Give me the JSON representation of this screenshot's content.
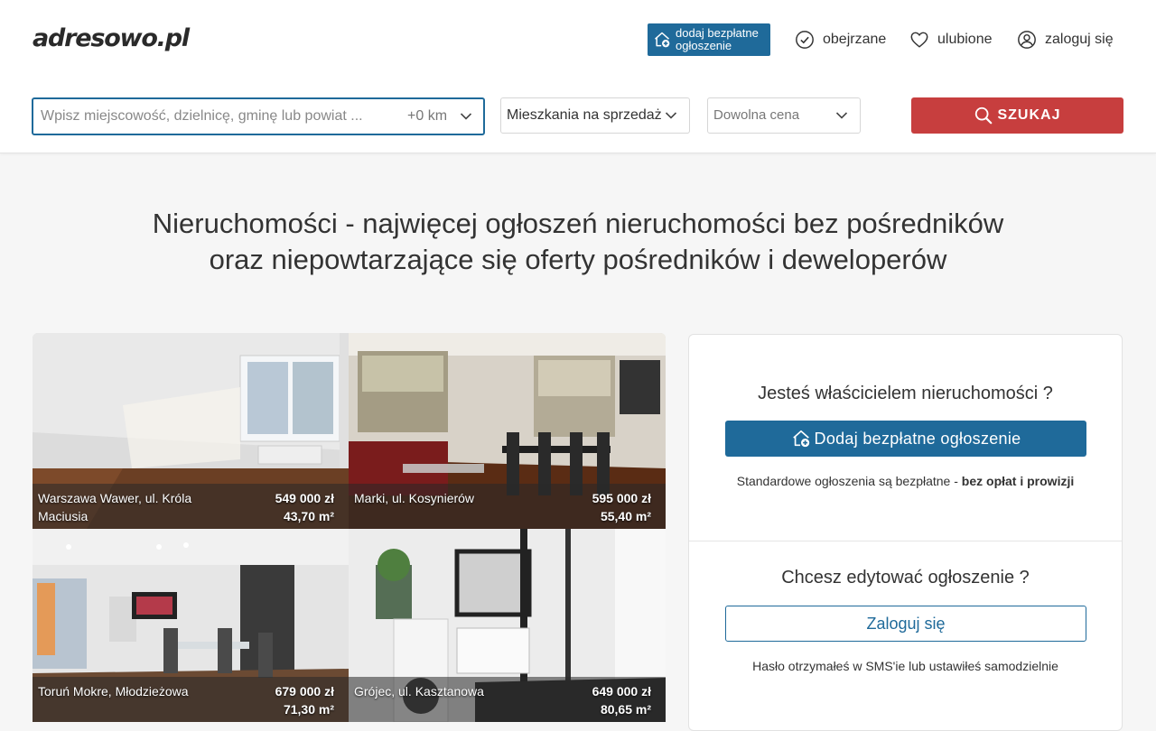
{
  "header": {
    "logo": "adresowo.pl",
    "add_listing_label": "dodaj bezpłatne ogłoszenie",
    "nav": [
      {
        "label": "obejrzane",
        "icon": "check-circle-icon"
      },
      {
        "label": "ulubione",
        "icon": "heart-icon"
      },
      {
        "label": "zaloguj się",
        "icon": "user-circle-icon"
      }
    ]
  },
  "search": {
    "placeholder": "Wpisz miejscowość, dzielnicę, gminę lub powiat ...",
    "radius": "+0 km",
    "category": "Mieszkania na sprzedaż",
    "price": "Dowolna cena",
    "button_label": "SZUKAJ"
  },
  "headline": {
    "line1": "Nieruchomości - najwięcej ogłoszeń nieruchomości bez pośredników",
    "line2": "oraz niepowtarzające się oferty pośredników i deweloperów"
  },
  "listings": [
    {
      "location": "Warszawa Wawer, ul. Króla Maciusia",
      "price": "549 000 zł",
      "area": "43,70 m²"
    },
    {
      "location": "Marki, ul. Kosynierów",
      "price": "595 000 zł",
      "area": "55,40 m²"
    },
    {
      "location": "Toruń Mokre, Młodzieżowa",
      "price": "679 000 zł",
      "area": "71,30 m²"
    },
    {
      "location": "Grójec, ul. Kasztanowa",
      "price": "649 000 zł",
      "area": "80,65 m²"
    }
  ],
  "owner_panel": {
    "title": "Jesteś właścicielem nieruchomości ?",
    "add_button": "Dodaj bezpłatne ogłoszenie",
    "note_prefix": "Standardowe ogłoszenia są bezpłatne - ",
    "note_bold": "bez opłat i prowizji",
    "edit_title": "Chcesz edytować ogłoszenie ?",
    "login_button": "Zaloguj się",
    "login_note": "Hasło otrzymałeś w SMS'ie lub ustawiłeś samodzielnie"
  },
  "colors": {
    "brand_blue": "#1f6a9a",
    "search_red": "#c73e3e"
  }
}
